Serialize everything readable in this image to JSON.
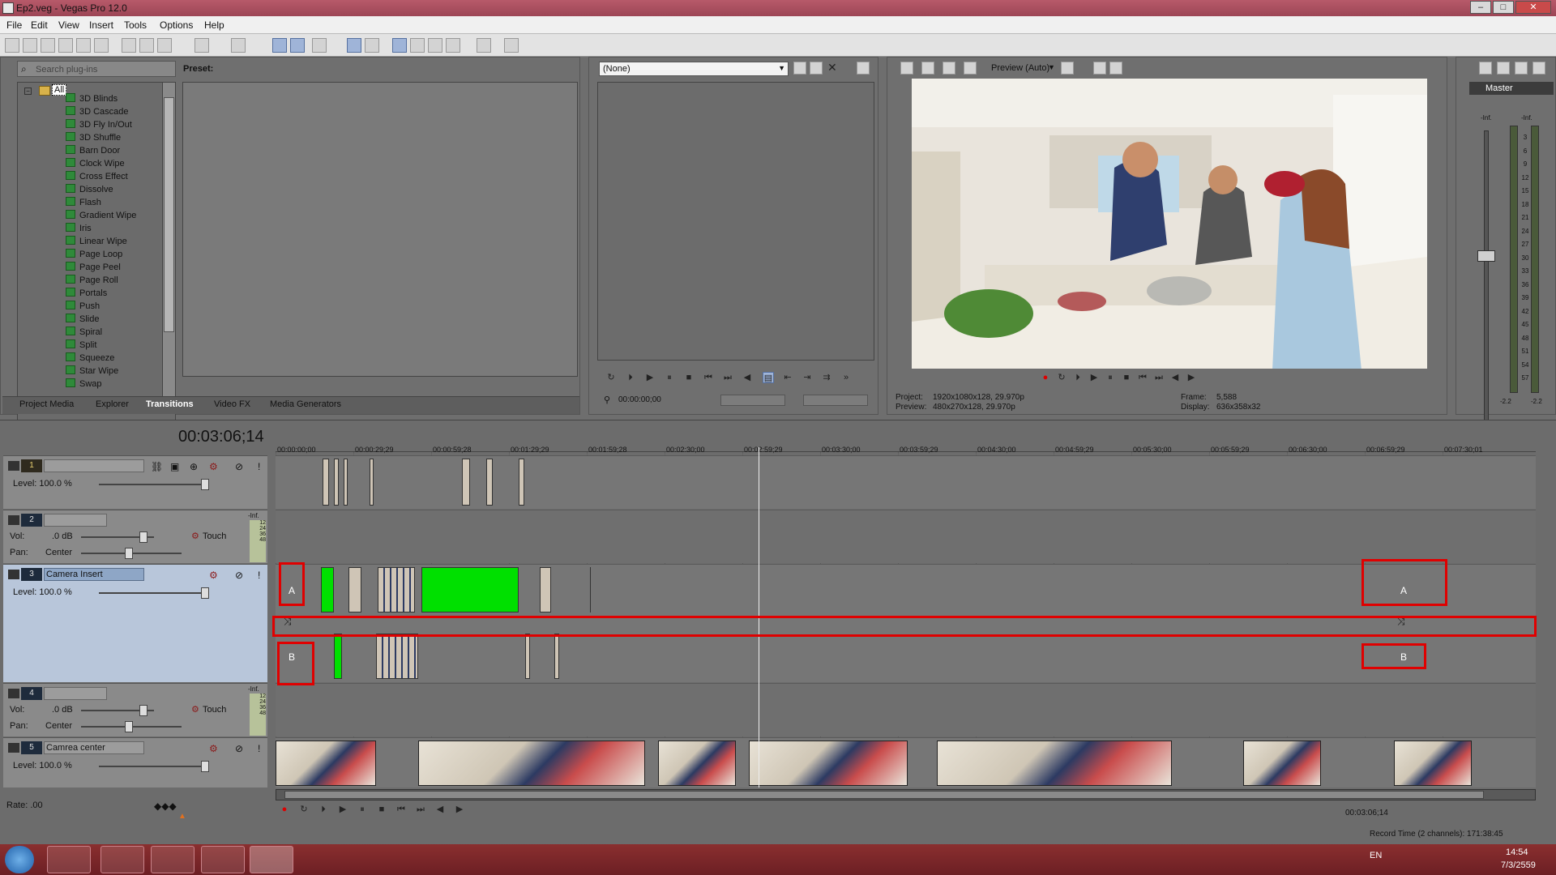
{
  "window": {
    "title": "Ep2.veg - Vegas Pro 12.0",
    "min": "–",
    "max": "□",
    "close": "✕"
  },
  "menu": [
    "File",
    "Edit",
    "View",
    "Insert",
    "Tools",
    "Options",
    "Help"
  ],
  "plugins": {
    "search_placeholder": "Search plug-ins",
    "preset_label": "Preset:",
    "root": "All",
    "items": [
      "3D Blinds",
      "3D Cascade",
      "3D Fly In/Out",
      "3D Shuffle",
      "Barn Door",
      "Clock Wipe",
      "Cross Effect",
      "Dissolve",
      "Flash",
      "Gradient Wipe",
      "Iris",
      "Linear Wipe",
      "Page Loop",
      "Page Peel",
      "Page Roll",
      "Portals",
      "Push",
      "Slide",
      "Spiral",
      "Split",
      "Squeeze",
      "Star Wipe",
      "Swap"
    ]
  },
  "tabs": [
    "Project Media",
    "Explorer",
    "Transitions",
    "Video FX",
    "Media Generators"
  ],
  "trimmer": {
    "selector": "(None)",
    "timecode": "00:00:00;00"
  },
  "preview": {
    "mode": "Preview (Auto)",
    "project_label": "Project:",
    "project": "1920x1080x128, 29.970p",
    "preview_label": "Preview:",
    "preview_val": "480x270x128, 29.970p",
    "frame_label": "Frame:",
    "frame": "5,588",
    "display_label": "Display:",
    "display": "636x358x32"
  },
  "master": {
    "label": "Master",
    "inf_l": "-Inf.",
    "inf_r": "-Inf.",
    "scale": [
      "3",
      "6",
      "9",
      "12",
      "15",
      "18",
      "21",
      "24",
      "27",
      "30",
      "33",
      "36",
      "39",
      "42",
      "45",
      "48",
      "51",
      "54",
      "57"
    ],
    "peak_l": "-2.2",
    "peak_r": "-2.2"
  },
  "timeline": {
    "timecode": "00:03:06;14",
    "ticks": [
      "00:00:00;00",
      "00:00:29;29",
      "00:00:59;28",
      "00:01:29;29",
      "00:01:59;28",
      "00:02:30;00",
      "00:02:59;29",
      "00:03:30;00",
      "00:03:59;29",
      "00:04:30;00",
      "00:04:59;29",
      "00:05:30;00",
      "00:05:59;29",
      "00:06:30;00",
      "00:06:59;29",
      "00:07:30;01"
    ],
    "tracks": [
      {
        "num": "1",
        "name": "",
        "level": "Level: 100.0 %"
      },
      {
        "num": "2",
        "name": "",
        "vol_label": "Vol:",
        "vol": ".0 dB",
        "pan_label": "Pan:",
        "pan": "Center",
        "touch": "Touch",
        "meter": "-Inf.",
        "meter_scale": [
          "12",
          "24",
          "36",
          "48"
        ]
      },
      {
        "num": "3",
        "name": "Camera Insert",
        "level": "Level: 100.0 %"
      },
      {
        "num": "4",
        "name": "",
        "vol_label": "Vol:",
        "vol": ".0 dB",
        "pan_label": "Pan:",
        "pan": "Center",
        "touch": "Touch",
        "meter": "-Inf.",
        "meter_scale": [
          "12",
          "24",
          "36",
          "48"
        ]
      },
      {
        "num": "5",
        "name": "Camrea center",
        "level": "Level: 100.0 %"
      }
    ],
    "label_a": "A",
    "label_b": "B",
    "rate": "Rate: .00",
    "bottom_timecode": "00:03:06;14",
    "record_time": "Record Time (2 channels): 171:38:45"
  },
  "taskbar": {
    "lang": "EN",
    "time": "14:54",
    "date": "7/3/2559"
  },
  "colors": {
    "title": "#a54d5d",
    "panel": "#6f6f6f",
    "selected_track": "#b8c6da",
    "green_clip": "#00e000",
    "highlight": "#e00000"
  }
}
